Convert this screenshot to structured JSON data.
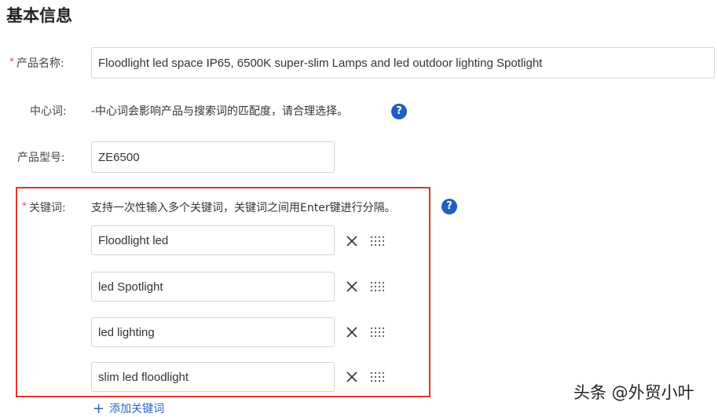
{
  "section": {
    "title": "基本信息"
  },
  "product_name": {
    "label": "产品名称:",
    "value": "Floodlight led space IP65, 6500K super-slim Lamps and led outdoor lighting Spotlight",
    "required": true
  },
  "center_word": {
    "label": "中心词:",
    "hint": "-中心词会影响产品与搜索词的匹配度，请合理选择。",
    "help": "?"
  },
  "model": {
    "label": "产品型号:",
    "value": "ZE6500"
  },
  "keywords": {
    "label": "关键词:",
    "required": true,
    "hint": "支持一次性输入多个关键词，关键词之间用Enter键进行分隔。",
    "help": "?",
    "items": [
      {
        "value": "Floodlight led"
      },
      {
        "value": "led Spotlight"
      },
      {
        "value": "led lighting"
      },
      {
        "value": "slim led floodlight"
      }
    ],
    "add_label": "添加关键词",
    "highlight_color": "#e0352b"
  },
  "watermark": "头条 @外贸小叶",
  "colors": {
    "accent": "#1f5fbf",
    "link": "#2b63c8",
    "required": "#e5484d"
  }
}
